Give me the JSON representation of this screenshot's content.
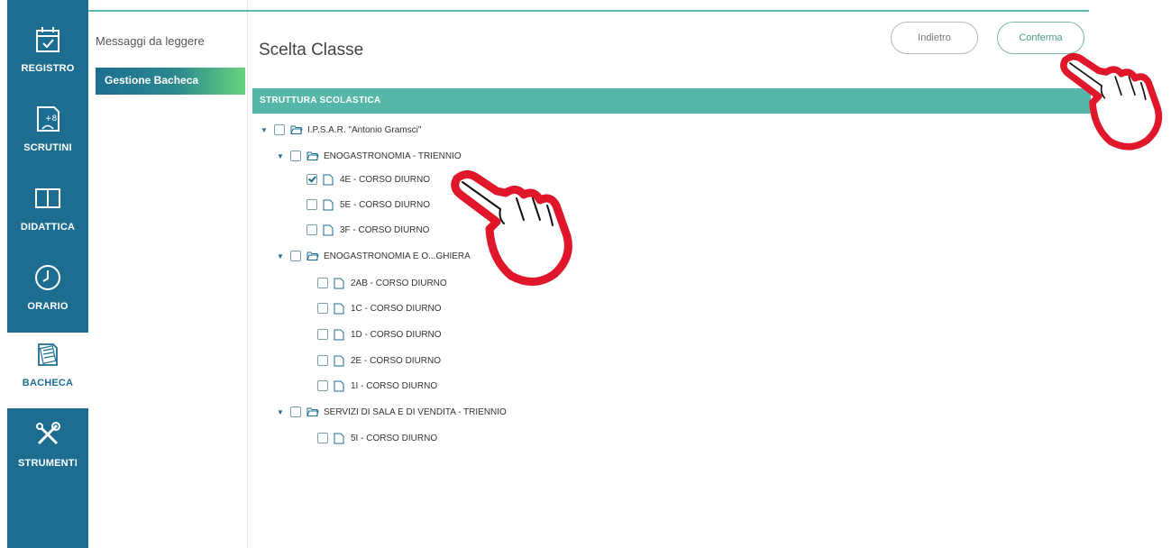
{
  "rail": {
    "items": [
      {
        "label": "REGISTRO",
        "icon": "calendar-check-icon"
      },
      {
        "label": "SCRUTINI",
        "icon": "grade-sheet-icon"
      },
      {
        "label": "DIDATTICA",
        "icon": "book-icon"
      },
      {
        "label": "ORARIO",
        "icon": "clock-icon"
      },
      {
        "label": "BACHECA",
        "icon": "notice-board-icon"
      },
      {
        "label": "STRUMENTI",
        "icon": "tools-icon"
      }
    ],
    "active": "BACHECA"
  },
  "submenu": {
    "items": [
      "Messaggi da leggere",
      "Gestione Bacheca"
    ],
    "active": "Gestione Bacheca"
  },
  "page": {
    "title": "Scelta Classe",
    "back_label": "Indietro",
    "confirm_label": "Conferma",
    "section_label": "STRUTTURA SCOLASTICA"
  },
  "tree": [
    {
      "label": "I.P.S.A.R. \"Antonio Gramsci\"",
      "type": "folder",
      "level": 0,
      "checked": false
    },
    {
      "label": "ENOGASTRONOMIA - TRIENNIO",
      "type": "folder",
      "level": 1,
      "checked": false
    },
    {
      "label": "4E - CORSO DIURNO",
      "type": "file",
      "level": 2,
      "checked": true
    },
    {
      "label": "5E - CORSO DIURNO",
      "type": "file",
      "level": 2,
      "checked": false
    },
    {
      "label": "3F - CORSO DIURNO",
      "type": "file",
      "level": 2,
      "checked": false
    },
    {
      "label": "ENOGASTRONOMIA E O...GHIERA",
      "type": "folder",
      "level": 1,
      "checked": false
    },
    {
      "label": "2AB - CORSO DIURNO",
      "type": "file",
      "level": 2,
      "checked": false
    },
    {
      "label": "1C - CORSO DIURNO",
      "type": "file",
      "level": 2,
      "checked": false
    },
    {
      "label": "1D - CORSO DIURNO",
      "type": "file",
      "level": 2,
      "checked": false
    },
    {
      "label": "2E - CORSO DIURNO",
      "type": "file",
      "level": 2,
      "checked": false
    },
    {
      "label": "1I - CORSO DIURNO",
      "type": "file",
      "level": 2,
      "checked": false
    },
    {
      "label": "SERVIZI DI SALA E DI VENDITA - TRIENNIO",
      "type": "folder",
      "level": 1,
      "checked": false
    },
    {
      "label": "5I - CORSO DIURNO",
      "type": "file",
      "level": 2,
      "checked": false
    }
  ],
  "colors": {
    "rail": "#1d6d91",
    "section_bar": "#56b6a8",
    "pointer_outline": "#e0162b"
  }
}
